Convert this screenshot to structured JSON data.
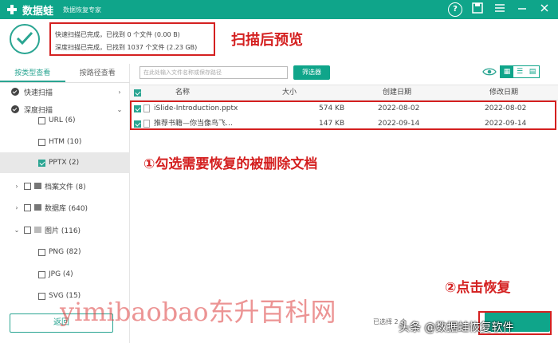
{
  "app": {
    "name": "数据蛙",
    "subtitle": "数据恢复专家",
    "help_icon": "?"
  },
  "status": {
    "line1": "快速扫描已完成，已找到 0 个文件 (0.00  B)",
    "line2": "深度扫描已完成，已找到 1037 个文件 (2.23 GB)"
  },
  "annotations": {
    "title": "扫描后预览",
    "step1": "①勾选需要恢复的被删除文档",
    "step2": "②点击恢复"
  },
  "sidebar": {
    "tabs": [
      "按类型查看",
      "按路径查看"
    ],
    "quick_scan": "快速扫描",
    "deep_scan": "深度扫描",
    "items": [
      {
        "label": "URL (6)"
      },
      {
        "label": "HTM (10)"
      },
      {
        "label": "PPTX (2)"
      },
      {
        "label": "档案文件 (8)"
      },
      {
        "label": "数据库 (640)"
      },
      {
        "label": "图片 (116)"
      },
      {
        "label": "PNG (82)"
      },
      {
        "label": "JPG (4)"
      },
      {
        "label": "SVG (15)"
      }
    ],
    "back_label": "返回"
  },
  "toolbar": {
    "search_placeholder": "在此处输入文件名称或保存路径",
    "filter_label": "筛选器"
  },
  "table": {
    "headers": [
      "名称",
      "大小",
      "创建日期",
      "修改日期"
    ],
    "rows": [
      {
        "name": "iSlide-Introduction.pptx",
        "size": "574 KB",
        "created": "2022-08-02",
        "modified": "2022-08-02"
      },
      {
        "name": "推荐书籍—你当像鸟飞…",
        "size": "147 KB",
        "created": "2022-09-14",
        "modified": "2022-09-14"
      }
    ]
  },
  "bottom": {
    "selected_text": "已选择 2 个"
  },
  "overlay": {
    "watermark": "yimibaobao东升百科网",
    "credit": "头条 @数据蛙恢复软件"
  },
  "colors": {
    "accent": "#0fa58a",
    "annotation": "#d42020"
  }
}
